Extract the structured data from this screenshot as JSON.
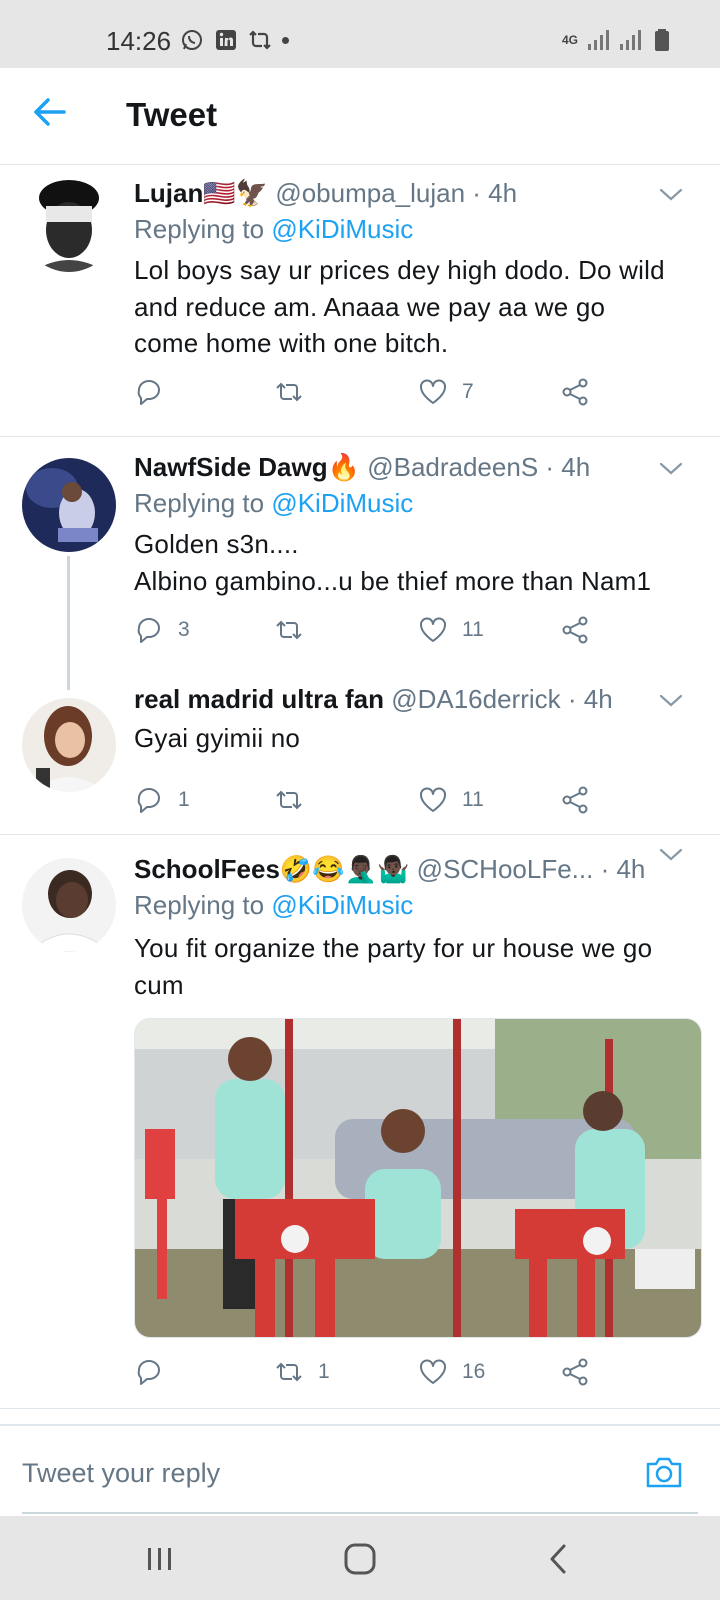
{
  "status": {
    "time": "14:26",
    "network": "4G"
  },
  "header": {
    "title": "Tweet"
  },
  "tweets": [
    {
      "name": "Lujan🇺🇸🦅",
      "handle": "@obumpa_lujan",
      "time": "· 4h",
      "replying_label": "Replying to",
      "mention": "@KiDiMusic",
      "lines": [
        "Lol boys say ur prices dey high dodo. Do wild",
        "and reduce am. Anaaa we pay aa we go",
        "come home with one bitch."
      ],
      "replies": "",
      "retweets": "",
      "likes": "7"
    },
    {
      "name": "NawfSide Dawg🔥",
      "handle": "@BadradeenS",
      "time": "· 4h",
      "replying_label": "Replying to",
      "mention": "@KiDiMusic",
      "lines": [
        "Golden s3n....",
        "Albino gambino...u be thief more than Nam1"
      ],
      "replies": "3",
      "retweets": "",
      "likes": "11"
    },
    {
      "name": "real madrid ultra fan",
      "handle": "@DA16derrick",
      "time": "· 4h",
      "lines": [
        "Gyai gyimii no"
      ],
      "replies": "1",
      "retweets": "",
      "likes": "11"
    },
    {
      "name": "SchoolFees🤣😂🤦🏿‍♂️🤷🏿‍♂️",
      "handle": "@SCHooLFe...",
      "time": "· 4h",
      "replying_label": "Replying to",
      "mention": "@KiDiMusic",
      "lines": [
        "You fit organize the party for ur house we go",
        "cum"
      ],
      "replies": "",
      "retweets": "1",
      "likes": "16"
    }
  ],
  "reply_bar": {
    "placeholder": "Tweet your reply"
  },
  "colors": {
    "accent": "#1da1f2",
    "muted": "#657786",
    "divider": "#e1e8ed",
    "text": "#14171a"
  },
  "icons": [
    "back-arrow-icon",
    "chevron-down-icon",
    "reply-icon",
    "retweet-icon",
    "like-icon",
    "share-icon",
    "camera-icon"
  ]
}
